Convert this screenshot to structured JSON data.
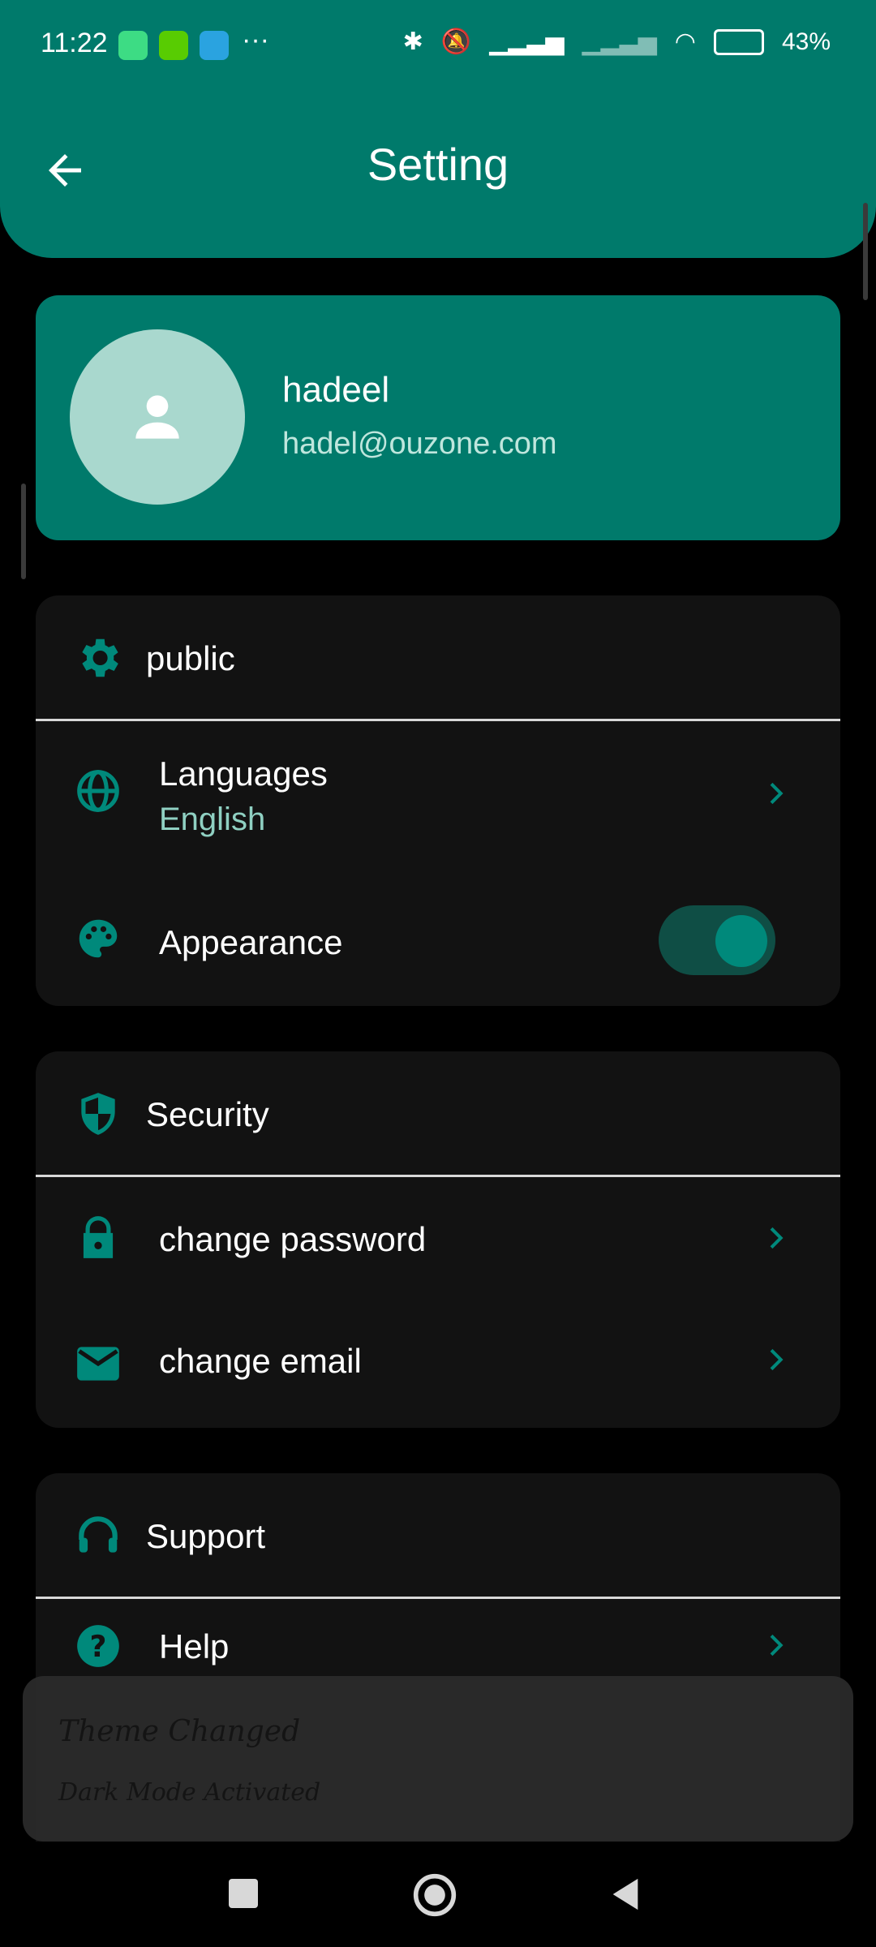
{
  "status_bar": {
    "time": "11:22",
    "battery": "43%",
    "icons": [
      "android-icon",
      "duolingo-icon",
      "telegram-icon",
      "more-icon",
      "bluetooth-icon",
      "mute-icon",
      "signal-icon",
      "signal-2-icon",
      "wifi-icon",
      "battery-icon"
    ]
  },
  "header": {
    "title": "Setting"
  },
  "profile": {
    "name": "hadeel",
    "email": "hadel@ouzone.com"
  },
  "sections": {
    "public": {
      "title": "public",
      "languages_label": "Languages",
      "languages_value": "English",
      "appearance_label": "Appearance",
      "appearance_toggle_on": true
    },
    "security": {
      "title": "Security",
      "change_password_label": "change password",
      "change_email_label": "change email"
    },
    "support": {
      "title": "Support",
      "help_label": "Help"
    }
  },
  "toast": {
    "title": "Theme Changed",
    "message": "Dark Mode Activated"
  },
  "colors": {
    "accent": "#007a6b",
    "accent_icon": "#00897b",
    "card_bg": "#121212",
    "background": "#000000"
  }
}
